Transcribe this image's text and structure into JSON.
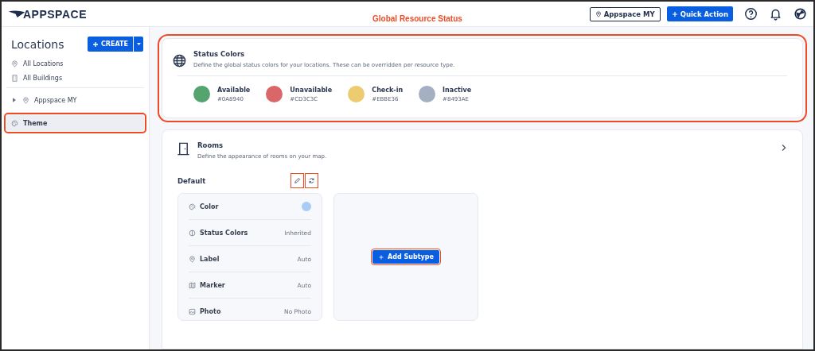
{
  "header": {
    "logo": "APPSPACE",
    "annotation": "Global Resource Status",
    "location_button": "Appspace MY",
    "quick_action": "Quick Action"
  },
  "sidebar": {
    "title": "Locations",
    "create_button": "CREATE",
    "items": [
      {
        "label": "All Locations",
        "selected": false,
        "highlighted": false
      },
      {
        "label": "All Buildings",
        "selected": false,
        "highlighted": false
      }
    ],
    "tree": [
      {
        "label": "Appspace MY",
        "expanded": false
      }
    ],
    "bottom_items": [
      {
        "label": "Theme",
        "selected": true,
        "highlighted": true
      }
    ]
  },
  "status_colors": {
    "title": "Status Colors",
    "description": "Define the global status colors for your locations. These can be overridden per resource type.",
    "highlighted": true,
    "colors": [
      {
        "name": "Available",
        "hex": "#0A8940",
        "color": "#55a470"
      },
      {
        "name": "Unavailable",
        "hex": "#CD3C3C",
        "color": "#d96769"
      },
      {
        "name": "Check-in",
        "hex": "#EBBE36",
        "color": "#eccb71"
      },
      {
        "name": "Inactive",
        "hex": "#8493AE",
        "color": "#a5afc2"
      }
    ]
  },
  "rooms": {
    "title": "Rooms",
    "description": "Define the appearance of rooms on your map.",
    "default_label": "Default",
    "actions_highlighted": true,
    "properties": [
      {
        "label": "Color",
        "kind": "swatch",
        "color": "#a8ccf5"
      },
      {
        "label": "Status Colors",
        "kind": "text",
        "value": "Inherited"
      },
      {
        "label": "Label",
        "kind": "text",
        "value": "Auto"
      },
      {
        "label": "Marker",
        "kind": "text",
        "value": "Auto"
      },
      {
        "label": "Photo",
        "kind": "text",
        "value": "No Photo"
      }
    ],
    "add_subtype": "Add Subtype",
    "add_subtype_highlighted": true
  }
}
